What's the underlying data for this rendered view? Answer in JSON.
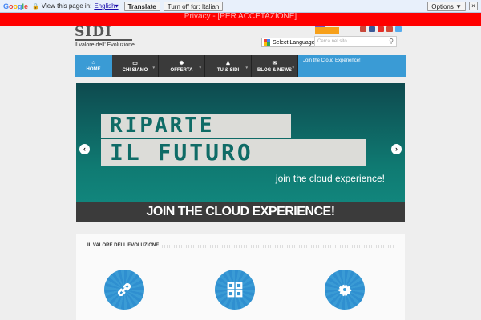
{
  "translate_bar": {
    "logo": [
      "G",
      "o",
      "o",
      "g",
      "l",
      "e"
    ],
    "view_text": "View this page in:",
    "language": "English",
    "language_caret": "▾",
    "translate_label": "Translate",
    "turn_off_label": "Turn off for: Italian",
    "options_label": "Options ▼",
    "close_label": "×"
  },
  "privacy": {
    "text": "Privacy - [PER ACCETAZIONE]"
  },
  "header": {
    "logo_text": "SIDI",
    "tagline": "Il valore dell' Evoluzione",
    "language_select_label": "Select Language",
    "language_select_caret": "▼",
    "search_placeholder": "Cerca nel sito...",
    "search_icon": "magnifier-icon"
  },
  "nav": {
    "home": "HOME",
    "items": [
      {
        "label": "CHI SIAMO",
        "icon": "sidi-logo-icon"
      },
      {
        "label": "OFFERTA",
        "icon": "gear-icon"
      },
      {
        "label": "TU & SIDI",
        "icon": "person-icon"
      },
      {
        "label": "BLOG & NEWS",
        "icon": "chat-icon"
      }
    ],
    "cloud_text": "Join the Cloud Experience!"
  },
  "hero": {
    "word1": "RIPARTE",
    "word_il": "IL",
    "word2": "FUTURO",
    "subtitle": "join the cloud experience!",
    "banner": "JOIN THE CLOUD EXPERIENCE!",
    "prev": "‹",
    "next": "›"
  },
  "section": {
    "title": "IL VALORE DELL'EVOLUZIONE",
    "features": [
      "link-icon",
      "grid-icon",
      "gear-icon"
    ]
  },
  "colors": {
    "accent": "#3a9bd5",
    "nav_dark": "#3a3a3a",
    "privacy_red": "#ff0000",
    "hero_teal": "#0f7a72"
  }
}
